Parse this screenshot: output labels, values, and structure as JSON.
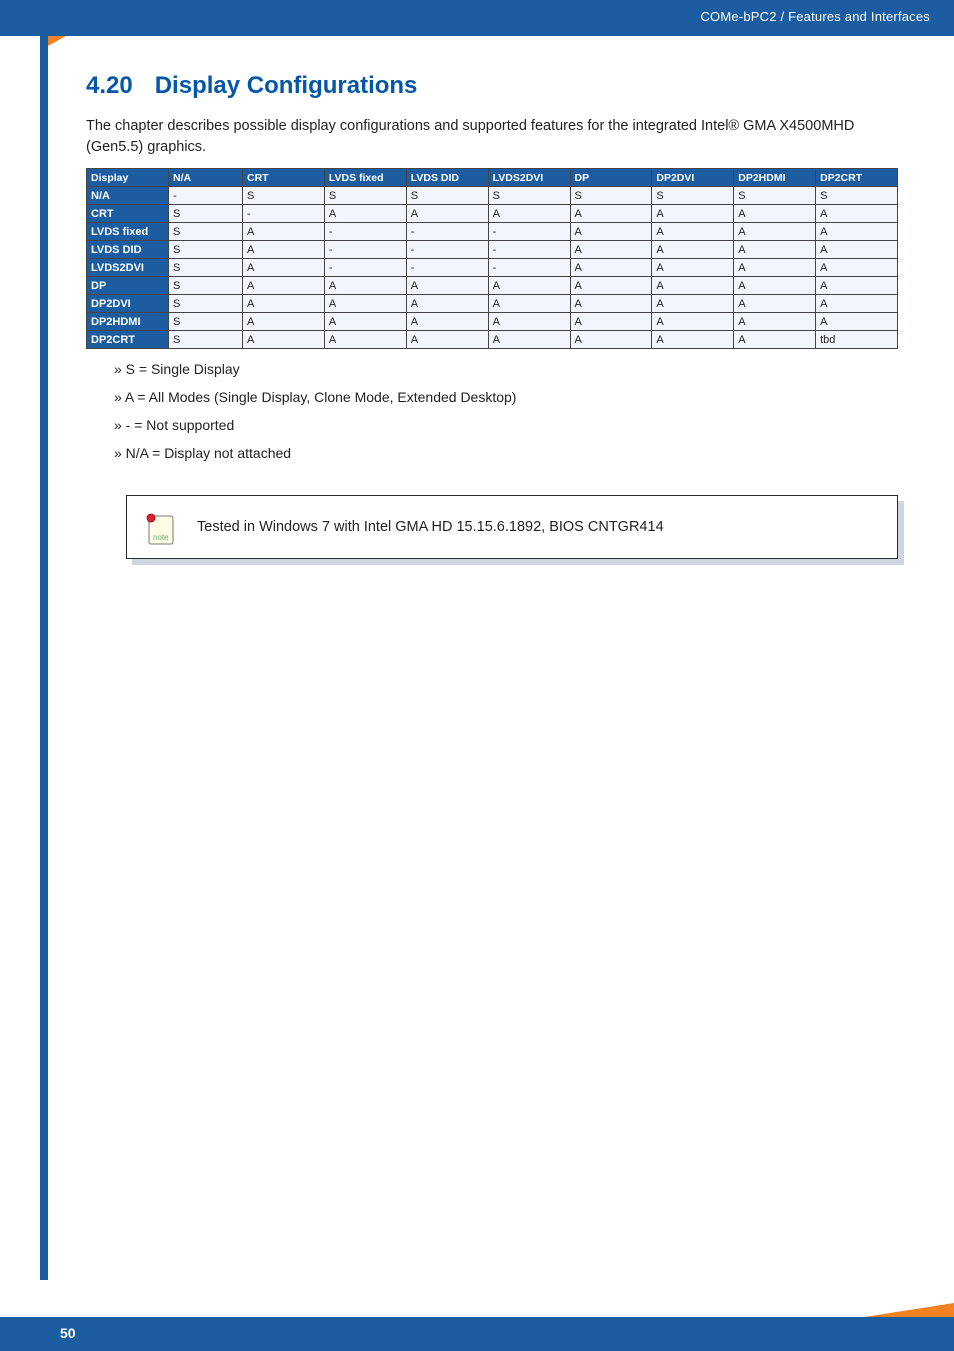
{
  "header": {
    "breadcrumb": "COMe-bPC2 / Features and Interfaces"
  },
  "section": {
    "number": "4.20",
    "title": "Display Configurations",
    "lead": "The chapter describes possible display configurations and supported features for the integrated Intel® GMA X4500MHD (Gen5.5) graphics."
  },
  "table": {
    "columns": [
      "Display",
      "N/A",
      "CRT",
      "LVDS fixed",
      "LVDS DID",
      "LVDS2DVI",
      "DP",
      "DP2DVI",
      "DP2HDMI",
      "DP2CRT"
    ],
    "rows": [
      {
        "head": "N/A",
        "cells": [
          "-",
          "S",
          "S",
          "S",
          "S",
          "S",
          "S",
          "S",
          "S"
        ]
      },
      {
        "head": "CRT",
        "cells": [
          "S",
          "-",
          "A",
          "A",
          "A",
          "A",
          "A",
          "A",
          "A"
        ]
      },
      {
        "head": "LVDS fixed",
        "cells": [
          "S",
          "A",
          "-",
          "-",
          "-",
          "A",
          "A",
          "A",
          "A"
        ]
      },
      {
        "head": "LVDS DID",
        "cells": [
          "S",
          "A",
          "-",
          "-",
          "-",
          "A",
          "A",
          "A",
          "A"
        ]
      },
      {
        "head": "LVDS2DVI",
        "cells": [
          "S",
          "A",
          "-",
          "-",
          "-",
          "A",
          "A",
          "A",
          "A"
        ]
      },
      {
        "head": "DP",
        "cells": [
          "S",
          "A",
          "A",
          "A",
          "A",
          "A",
          "A",
          "A",
          "A"
        ]
      },
      {
        "head": "DP2DVI",
        "cells": [
          "S",
          "A",
          "A",
          "A",
          "A",
          "A",
          "A",
          "A",
          "A"
        ]
      },
      {
        "head": "DP2HDMI",
        "cells": [
          "S",
          "A",
          "A",
          "A",
          "A",
          "A",
          "A",
          "A",
          "A"
        ]
      },
      {
        "head": "DP2CRT",
        "cells": [
          "S",
          "A",
          "A",
          "A",
          "A",
          "A",
          "A",
          "A",
          "tbd"
        ]
      }
    ]
  },
  "legend": {
    "s": "» S = Single Display",
    "a": "» A = All Modes (Single Display, Clone Mode, Extended Desktop)",
    "dash": "» - = Not supported",
    "na": "» N/A = Display not attached"
  },
  "note": {
    "text": "Tested in Windows 7 with Intel GMA HD 15.15.6.1892, BIOS CNTGR414"
  },
  "footer": {
    "page": "50"
  }
}
